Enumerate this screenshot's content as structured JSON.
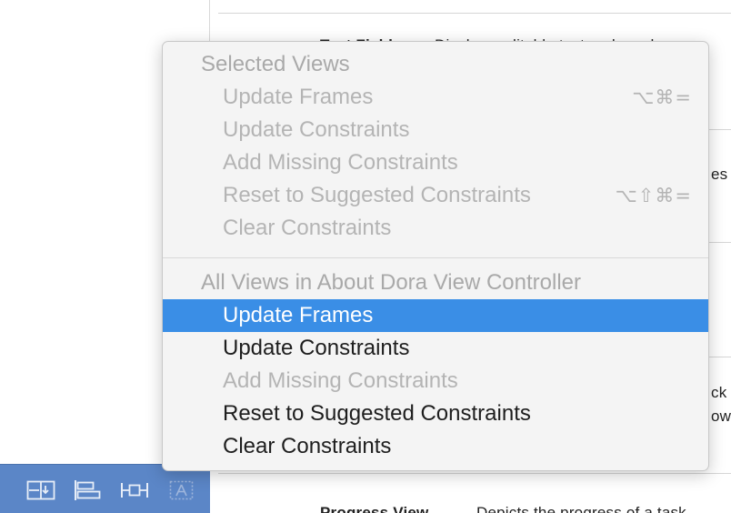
{
  "background": {
    "peek_lines": [
      {
        "text": "Text Field",
        "bold": true
      },
      {
        "text": "Displays editable text and sends a",
        "bold": false
      },
      {
        "text": "es",
        "bold": false
      },
      {
        "text": "ck",
        "bold": false
      },
      {
        "text": "ow",
        "bold": false
      },
      {
        "text": "Progress View",
        "bold": true
      },
      {
        "text": "Depicts the progress of a task",
        "bold": false
      }
    ]
  },
  "toolbar": {
    "buttons": [
      {
        "icon": "embed-in-stack-icon"
      },
      {
        "icon": "align-icon"
      },
      {
        "icon": "pin-icon"
      },
      {
        "icon": "resolve-auto-layout-issues-icon"
      }
    ]
  },
  "menu": {
    "sections": [
      {
        "header": "Selected Views",
        "items": [
          {
            "label": "Update Frames",
            "shortcut": "⌥⌘=",
            "enabled": false,
            "selected": false
          },
          {
            "label": "Update Constraints",
            "shortcut": "",
            "enabled": false,
            "selected": false
          },
          {
            "label": "Add Missing Constraints",
            "shortcut": "",
            "enabled": false,
            "selected": false
          },
          {
            "label": "Reset to Suggested Constraints",
            "shortcut": "⌥⇧⌘=",
            "enabled": false,
            "selected": false
          },
          {
            "label": "Clear Constraints",
            "shortcut": "",
            "enabled": false,
            "selected": false
          }
        ]
      },
      {
        "header": "All Views in About Dora View Controller",
        "items": [
          {
            "label": "Update Frames",
            "shortcut": "",
            "enabled": true,
            "selected": true
          },
          {
            "label": "Update Constraints",
            "shortcut": "",
            "enabled": true,
            "selected": false
          },
          {
            "label": "Add Missing Constraints",
            "shortcut": "",
            "enabled": false,
            "selected": false
          },
          {
            "label": "Reset to Suggested Constraints",
            "shortcut": "",
            "enabled": true,
            "selected": false
          },
          {
            "label": "Clear Constraints",
            "shortcut": "",
            "enabled": true,
            "selected": false
          }
        ]
      }
    ]
  },
  "colors": {
    "selection": "#3a8ee6",
    "toolbar": "#5b86c7",
    "disabled_text": "#b4b4b4"
  }
}
